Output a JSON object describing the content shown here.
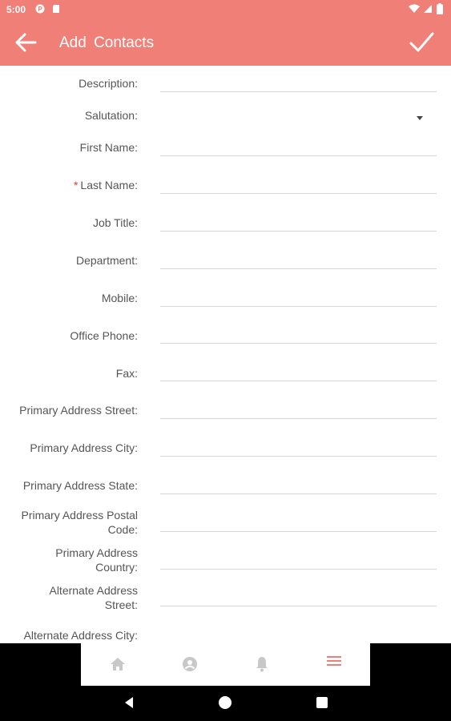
{
  "status_bar": {
    "time": "5:00",
    "icons": [
      "app-icon",
      "sd-card-icon",
      "wifi-icon",
      "signal-icon",
      "battery-icon"
    ]
  },
  "app_bar": {
    "title": "Add  Contacts",
    "back_icon": "arrow-back-icon",
    "save_icon": "check-icon"
  },
  "form": {
    "fields": [
      {
        "label": "Description:",
        "value": "",
        "required": false,
        "type": "text"
      },
      {
        "label": "Salutation:",
        "value": "",
        "required": false,
        "type": "select"
      },
      {
        "label": "First Name:",
        "value": "",
        "required": false,
        "type": "text"
      },
      {
        "label": "Last Name:",
        "value": "",
        "required": true,
        "type": "text"
      },
      {
        "label": "Job Title:",
        "value": "",
        "required": false,
        "type": "text"
      },
      {
        "label": "Department:",
        "value": "",
        "required": false,
        "type": "text"
      },
      {
        "label": "Mobile:",
        "value": "",
        "required": false,
        "type": "text"
      },
      {
        "label": "Office Phone:",
        "value": "",
        "required": false,
        "type": "text"
      },
      {
        "label": "Fax:",
        "value": "",
        "required": false,
        "type": "text"
      },
      {
        "label": "Primary Address Street:",
        "value": "",
        "required": false,
        "type": "text"
      },
      {
        "label": "Primary Address City:",
        "value": "",
        "required": false,
        "type": "text"
      },
      {
        "label": "Primary Address State:",
        "value": "",
        "required": false,
        "type": "text"
      },
      {
        "label": "Primary Address Postal Code:",
        "value": "",
        "required": false,
        "type": "text"
      },
      {
        "label": "Primary Address Country:",
        "value": "",
        "required": false,
        "type": "text"
      },
      {
        "label": "Alternate Address Street:",
        "value": "",
        "required": false,
        "type": "text"
      },
      {
        "label": "Alternate Address City:",
        "value": "",
        "required": false,
        "type": "text"
      }
    ],
    "required_marker": "*"
  },
  "bottom_nav": {
    "items": [
      {
        "icon": "home-icon",
        "active": false
      },
      {
        "icon": "profile-icon",
        "active": false
      },
      {
        "icon": "bell-icon",
        "active": false
      },
      {
        "icon": "menu-icon",
        "active": true
      }
    ],
    "inactive_color": "#c8c8c8",
    "active_color": "#ef7f77"
  },
  "system_nav": {
    "icons": [
      "back-triangle-icon",
      "home-circle-icon",
      "recents-square-icon"
    ]
  },
  "colors": {
    "accent": "#ef7f77",
    "required": "#e53935"
  }
}
